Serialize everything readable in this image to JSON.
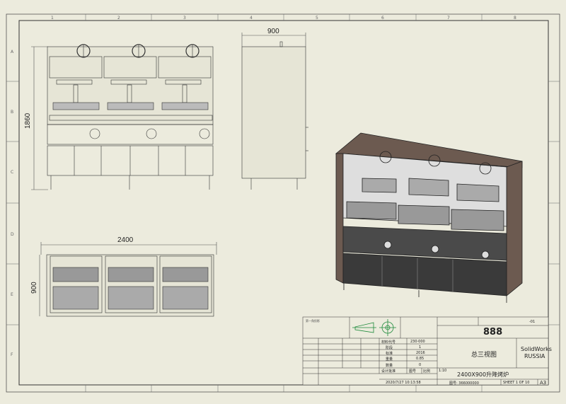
{
  "drawing": {
    "dims": {
      "front_width": "2400",
      "top_depth": "900",
      "front_height": "1860",
      "side_width": "900",
      "top_width": "2400"
    },
    "col_zones": [
      "1",
      "2",
      "3",
      "4",
      "5",
      "6",
      "7",
      "8"
    ],
    "row_zones": [
      "A",
      "B",
      "C",
      "D",
      "E",
      "F"
    ]
  },
  "title_block": {
    "drawing_no": "888",
    "view_name": "总三视图",
    "company_line1": "SolidWorks",
    "company_line2": "RUSSIA",
    "product_name": "2400X900升降烤炉",
    "date": "2020/7/27 10:13:58",
    "sheet_label": "SHEET 1 OF 10",
    "paper_size": "A3",
    "part_no": "图号: 366000000",
    "scale_label": "比例",
    "scale_value": "1:10",
    "designer_label": "设计批准",
    "rows": [
      {
        "label": "材料代号",
        "value": "230·000"
      },
      {
        "label": "阶段",
        "value": "1"
      },
      {
        "label": "标准",
        "value": "2016"
      },
      {
        "label": "重量",
        "value": "0.85"
      },
      {
        "label": "数量",
        "value": "0"
      },
      {
        "label": "设计批准",
        "value": "图号"
      }
    ],
    "rev_col": "-01",
    "proj_label": "第一角投影"
  }
}
